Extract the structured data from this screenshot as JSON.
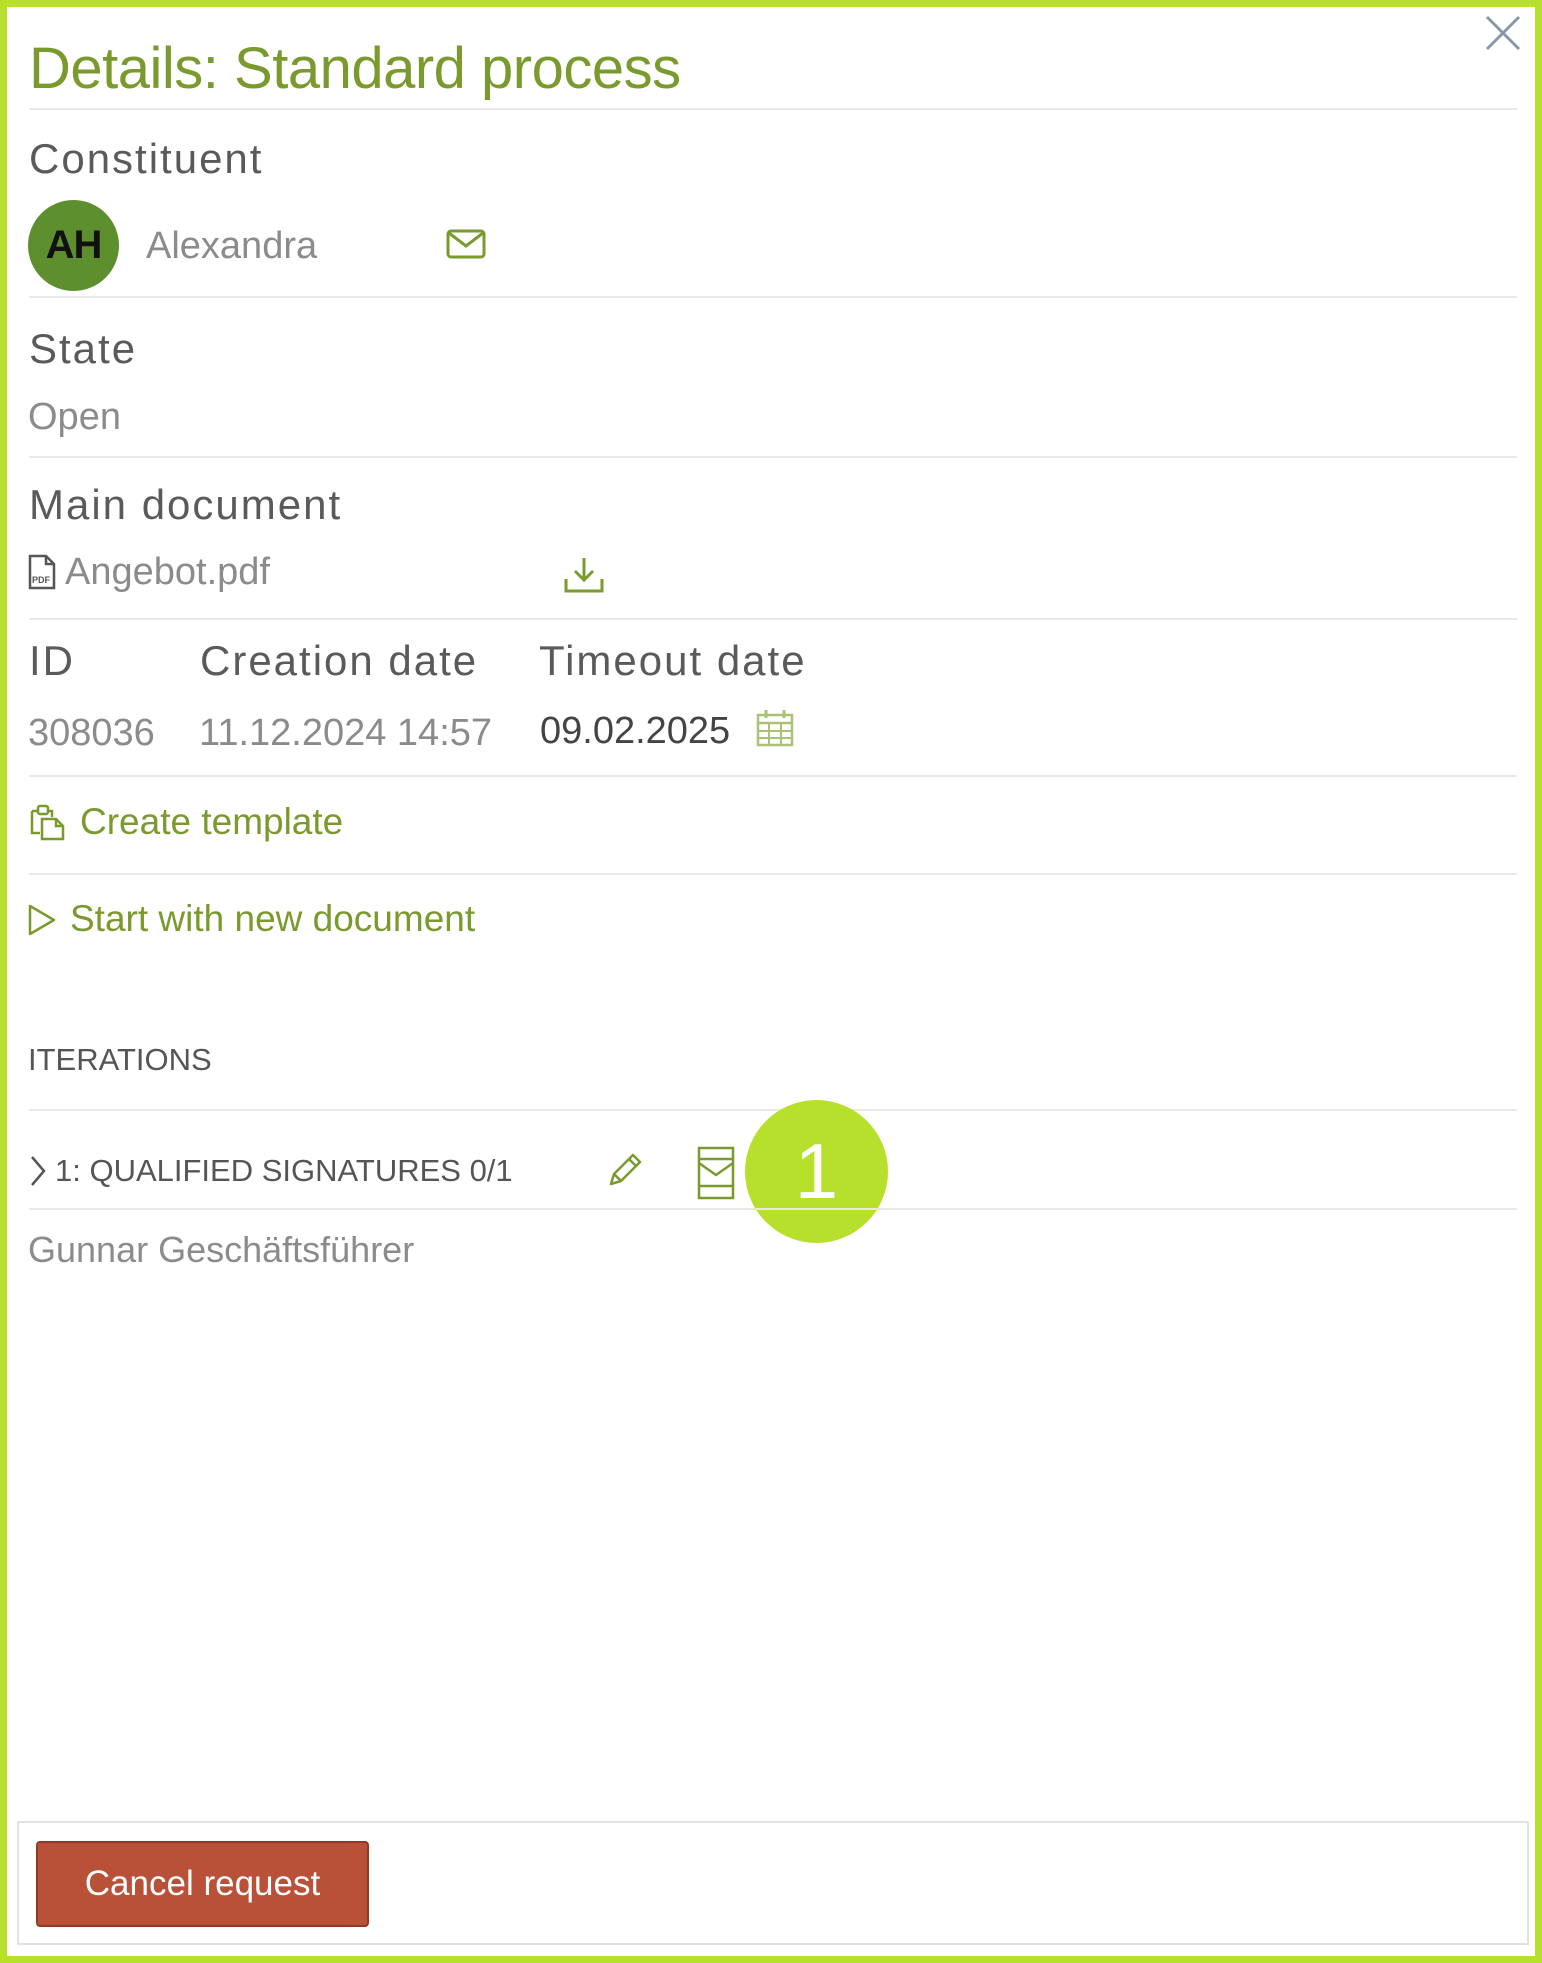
{
  "panel": {
    "title": "Details: Standard process",
    "close_label": "close"
  },
  "constituent": {
    "label": "Constituent",
    "avatar_initials": "AH",
    "name": "Alexandra"
  },
  "state": {
    "label": "State",
    "value": "Open"
  },
  "main_document": {
    "label": "Main document",
    "file_name": "Angebot.pdf"
  },
  "meta": {
    "id_label": "ID",
    "id_value": "308036",
    "creation_label": "Creation date",
    "creation_value": "11.12.2024 14:57",
    "timeout_label": "Timeout date",
    "timeout_value": "09.02.2025"
  },
  "actions": {
    "create_template": "Create template",
    "start_new_document": "Start with new document"
  },
  "iterations": {
    "heading": "ITERATIONS",
    "items": [
      {
        "title": "1: QUALIFIED SIGNATURES 0/1",
        "signer": "Gunnar Geschäftsführer"
      }
    ]
  },
  "annotation": {
    "badge_number": "1"
  },
  "footer": {
    "cancel_label": "Cancel request"
  },
  "colors": {
    "frame": "#b6e02c",
    "accent": "#7a9a2e",
    "danger": "#b95038",
    "avatar": "#5e8f2e"
  }
}
